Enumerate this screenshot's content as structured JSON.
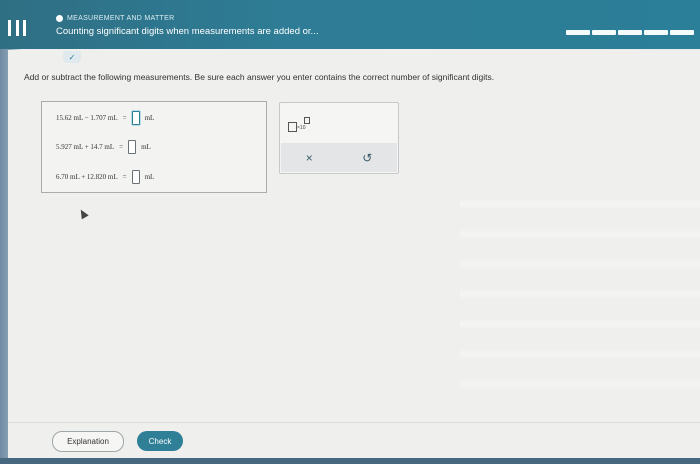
{
  "header": {
    "topic": "MEASUREMENT AND MATTER",
    "title": "Counting significant digits when measurements are added or..."
  },
  "instruction": "Add or subtract the following measurements. Be sure each answer you enter contains the correct number of significant digits.",
  "problems": [
    {
      "expression": "15.62 mL − 1.707 mL",
      "equals": "=",
      "unit": "mL"
    },
    {
      "expression": "5.927 mL + 14.7 mL",
      "equals": "=",
      "unit": "mL"
    },
    {
      "expression": "6.70 mL + 12.820 mL",
      "equals": "=",
      "unit": "mL"
    }
  ],
  "tools": {
    "sci_notation_label": "×10",
    "clear_symbol": "×",
    "undo_symbol": "↺"
  },
  "buttons": {
    "explanation": "Explanation",
    "check": "Check"
  },
  "colors": {
    "header": "#2e7c95",
    "check_button": "#2f7f96"
  }
}
